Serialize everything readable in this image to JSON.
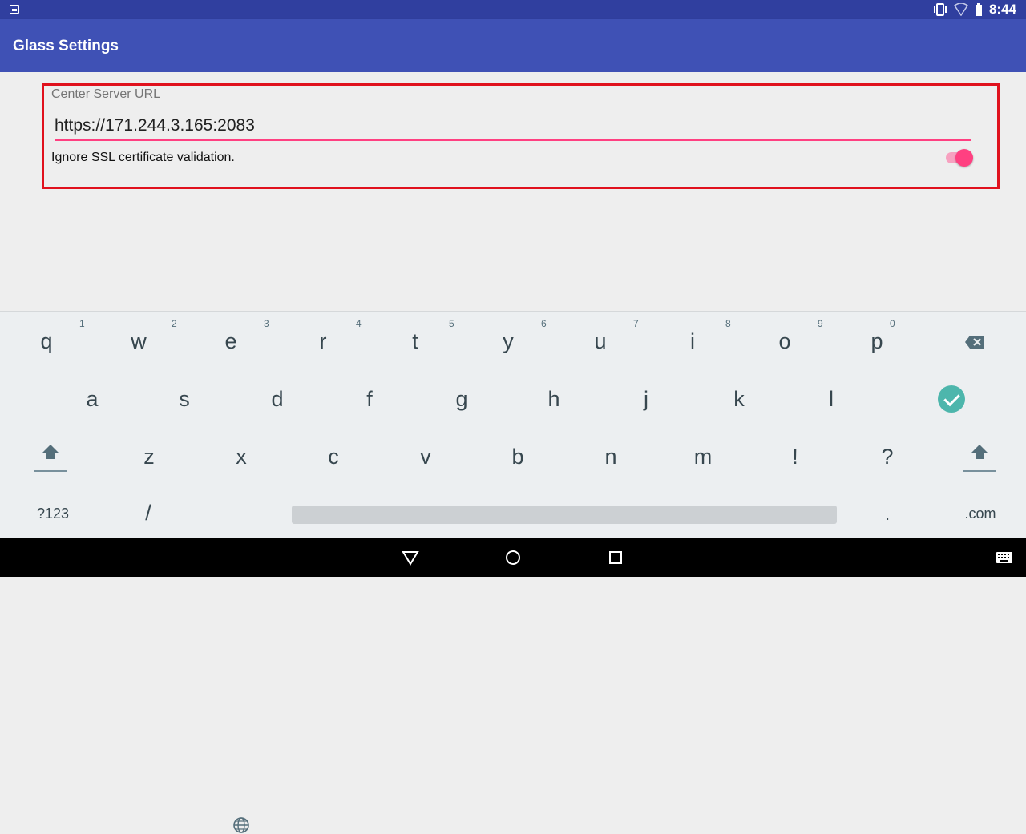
{
  "status_bar": {
    "time": "8:44"
  },
  "app_bar": {
    "title": "Glass Settings"
  },
  "settings": {
    "server_url_label": "Center Server URL",
    "server_url_value": "https://171.244.3.165:2083",
    "ssl_label": "Ignore SSL certificate validation.",
    "ssl_enabled": true
  },
  "keyboard": {
    "row1": [
      "q",
      "w",
      "e",
      "r",
      "t",
      "y",
      "u",
      "i",
      "o",
      "p"
    ],
    "row1_hints": [
      "",
      "1",
      "2",
      "3",
      "4",
      "5",
      "6",
      "7",
      "8",
      "9",
      "0"
    ],
    "row2": [
      "a",
      "s",
      "d",
      "f",
      "g",
      "h",
      "j",
      "k",
      "l"
    ],
    "row3": [
      "z",
      "x",
      "c",
      "v",
      "b",
      "n",
      "m",
      "!",
      "?"
    ],
    "symbols_label": "?123",
    "slash_label": "/",
    "period_label": ".",
    "com_label": ".com"
  },
  "colors": {
    "primary": "#3f51b5",
    "primary_dark": "#303f9f",
    "accent": "#ff4081",
    "highlight": "#e0111d",
    "enter": "#4db6ac"
  }
}
